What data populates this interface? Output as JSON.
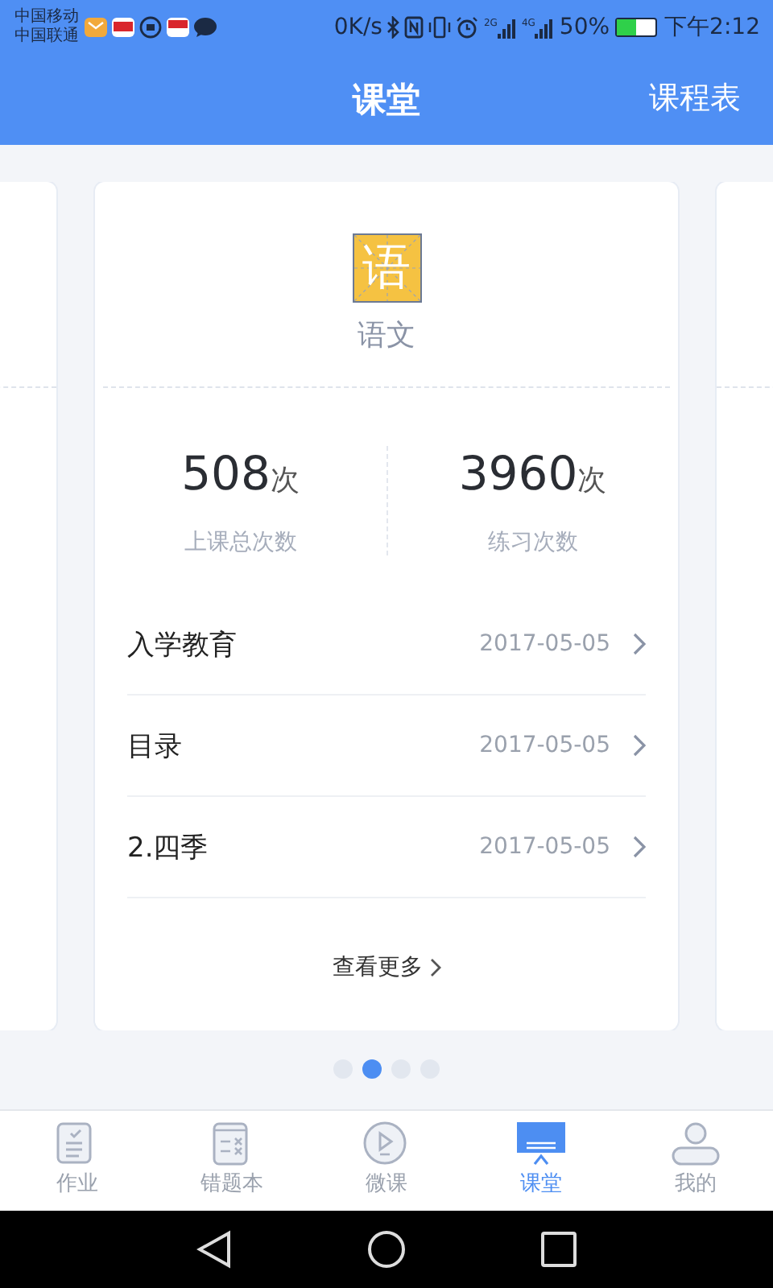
{
  "status_bar": {
    "carriers": [
      "中国移动",
      "中国联通"
    ],
    "speed": "0K/s",
    "network_1": "2G",
    "network_2": "4G",
    "battery_text": "50%",
    "time": "下午2:12"
  },
  "header": {
    "title": "课堂",
    "action": "课程表"
  },
  "card": {
    "icon_char": "语",
    "subject": "语文",
    "stats": [
      {
        "value": "508",
        "unit": "次",
        "label": "上课总次数"
      },
      {
        "value": "3960",
        "unit": "次",
        "label": "练习次数"
      }
    ],
    "lessons": [
      {
        "title": "入学教育",
        "date": "2017-05-05"
      },
      {
        "title": "目录",
        "date": "2017-05-05"
      },
      {
        "title": "2.四季",
        "date": "2017-05-05"
      }
    ],
    "more": "查看更多"
  },
  "pager": [
    {
      "selected": false
    },
    {
      "selected": true
    },
    {
      "selected": false
    },
    {
      "selected": false
    }
  ],
  "tabs": [
    {
      "kind": "homework",
      "label": "作业",
      "selected": false
    },
    {
      "kind": "mistakes",
      "label": "错题本",
      "selected": false
    },
    {
      "kind": "video",
      "label": "微课",
      "selected": false
    },
    {
      "kind": "classroom",
      "label": "课堂",
      "selected": true
    },
    {
      "kind": "profile",
      "label": "我的",
      "selected": false
    }
  ]
}
